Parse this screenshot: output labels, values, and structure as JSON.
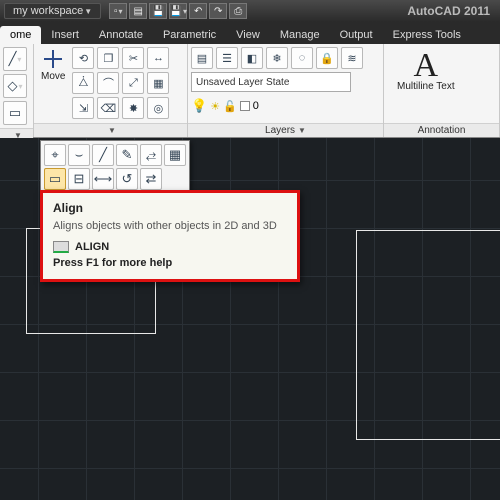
{
  "brand": "AutoCAD 2011",
  "workspace_label": "my workspace",
  "tabs": [
    "ome",
    "Insert",
    "Annotate",
    "Parametric",
    "View",
    "Manage",
    "Output",
    "Express Tools"
  ],
  "active_tab_index": 0,
  "ribbon": {
    "move_label": "Move",
    "layers_label": "Layers",
    "annotation_label": "Annotation",
    "layer_state": "Unsaved Layer State",
    "layer_current": "0",
    "mtext_label": "Multiline Text"
  },
  "tooltip": {
    "title": "Align",
    "desc": "Aligns objects with other objects in 2D and 3D",
    "command": "ALIGN",
    "help": "Press F1 for more help"
  },
  "qat_icons": [
    "new",
    "open",
    "save",
    "undo",
    "redo",
    "plot",
    "print"
  ]
}
